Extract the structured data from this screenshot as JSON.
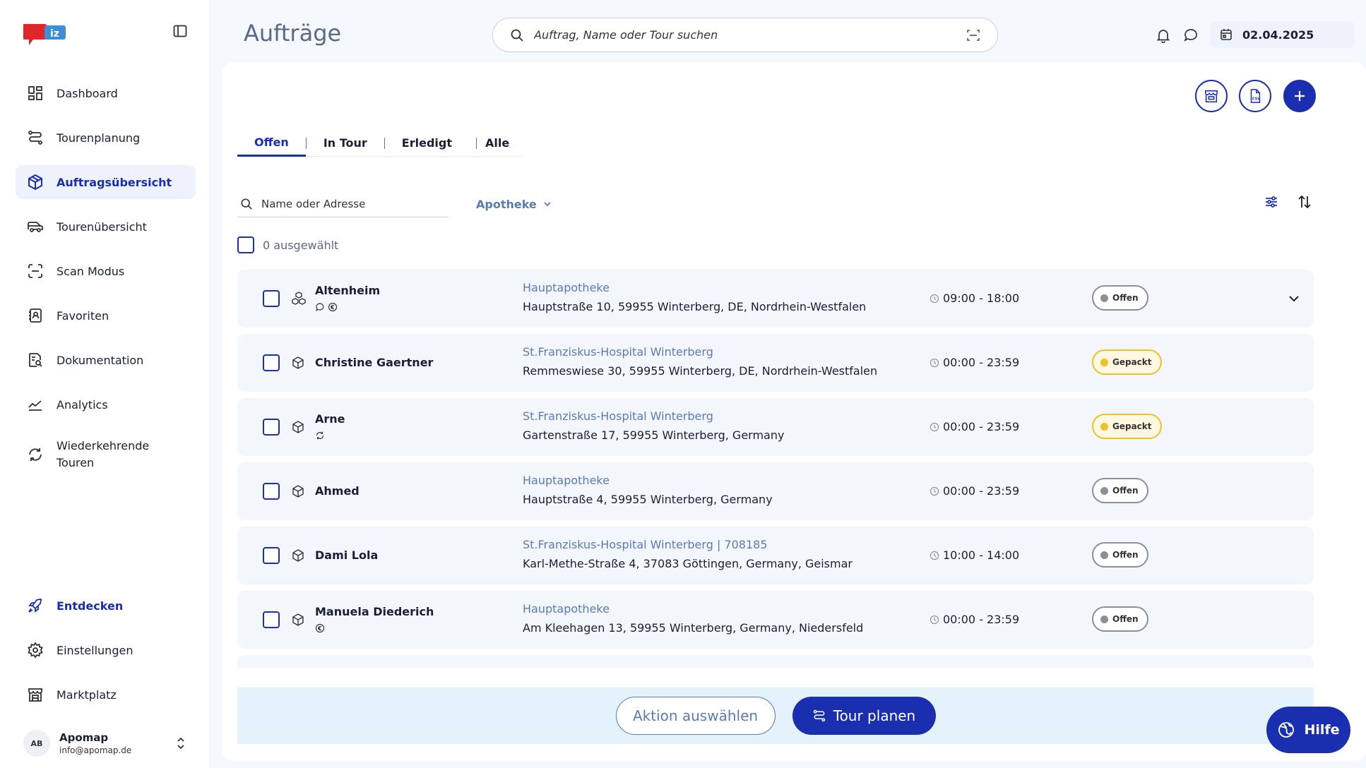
{
  "app": {
    "logo_text": "iz"
  },
  "header": {
    "title": "Aufträge",
    "search_placeholder": "Auftrag, Name oder Tour suchen",
    "date": "02.04.2025"
  },
  "sidebar": {
    "items": [
      {
        "label": "Dashboard",
        "icon": "dashboard-icon"
      },
      {
        "label": "Tourenplanung",
        "icon": "route-icon"
      },
      {
        "label": "Auftragsübersicht",
        "icon": "package-icon",
        "active": true
      },
      {
        "label": "Tourenübersicht",
        "icon": "van-icon"
      },
      {
        "label": "Scan Modus",
        "icon": "scan-icon"
      },
      {
        "label": "Favoriten",
        "icon": "contacts-icon"
      },
      {
        "label": "Dokumentation",
        "icon": "document-search-icon"
      },
      {
        "label": "Analytics",
        "icon": "chart-line-icon"
      },
      {
        "label": "Wiederkehrende Touren",
        "icon": "repeat-icon"
      }
    ],
    "bottom": [
      {
        "label": "Entdecken",
        "icon": "rocket-icon"
      },
      {
        "label": "Einstellungen",
        "icon": "gear-icon"
      },
      {
        "label": "Marktplatz",
        "icon": "store-icon"
      }
    ],
    "user": {
      "initials": "AB",
      "name": "Apomap",
      "email": "info@apomap.de"
    }
  },
  "tabs": [
    "Offen",
    "In Tour",
    "Erledigt",
    "Alle"
  ],
  "filters": {
    "name_placeholder": "Name oder Adresse",
    "pharmacy_dropdown": "Apotheke",
    "selected_text": "0 ausgewählt"
  },
  "orders": [
    {
      "name": "Altenheim",
      "pharmacy": "Hauptapotheke",
      "address": "Hauptstraße 10, 59955 Winterberg, DE, Nordrhein-Westfalen",
      "time": "09:00 - 18:00",
      "status": "Offen"
    },
    {
      "name": "Christine Gaertner",
      "pharmacy": "St.Franziskus-Hospital Winterberg",
      "address": "Remmeswiese 30, 59955 Winterberg, DE, Nordrhein-Westfalen",
      "time": "00:00 - 23:59",
      "status": "Gepackt"
    },
    {
      "name": "Arne",
      "pharmacy": "St.Franziskus-Hospital Winterberg",
      "address": "Gartenstraße 17, 59955 Winterberg, Germany",
      "time": "00:00 - 23:59",
      "status": "Gepackt"
    },
    {
      "name": "Ahmed",
      "pharmacy": "Hauptapotheke",
      "address": "Hauptstraße 4, 59955 Winterberg, Germany",
      "time": "00:00 - 23:59",
      "status": "Offen"
    },
    {
      "name": "Dami Lola",
      "pharmacy": "St.Franziskus-Hospital Winterberg | 708185",
      "address": "Karl-Methe-Straße 4, 37083 Göttingen, Germany, Geismar",
      "time": "10:00 - 14:00",
      "status": "Offen"
    },
    {
      "name": "Manuela Diederich",
      "pharmacy": "Hauptapotheke",
      "address": "Am Kleehagen 13, 59955 Winterberg, Germany, Niedersfeld",
      "time": "00:00 - 23:59",
      "status": "Offen"
    }
  ],
  "actions": {
    "select_action": "Aktion auswählen",
    "plan_tour": "Tour planen",
    "help": "Hilfe"
  },
  "colors": {
    "primary": "#1a2fb0",
    "muted_blue": "#5a7bb8",
    "status_open": "#8a8f98",
    "status_packed": "#f0c02a"
  }
}
